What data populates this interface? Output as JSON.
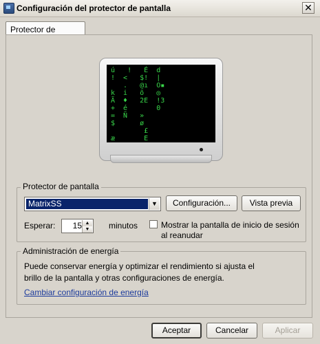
{
  "window": {
    "title": "Configuración del protector de pantalla",
    "close_label": "✕"
  },
  "tabs": [
    {
      "label": "Protector de pantalla",
      "selected": true
    }
  ],
  "preview": {
    "screen_glyphs": [
      "ú   !   É  d",
      "!  <   $!  |",
      "   .   @ı  O▪",
      "k  i   õ   ◎",
      "Ã  ♦   2E  !3",
      "+  é       0",
      "=  Ñ   »",
      "$      ø",
      "        £",
      "æ       E"
    ]
  },
  "screensaver_group": {
    "label": "Protector de pantalla",
    "selected_screensaver": "MatrixSS",
    "settings_button": "Configuración...",
    "preview_button": "Vista previa",
    "wait_label": "Esperar:",
    "wait_value": "15",
    "wait_unit": "minutos",
    "resume_checkbox_label_line1": "Mostrar la pantalla de inicio de sesión",
    "resume_checkbox_label_line2": "al reanudar",
    "resume_checked": false
  },
  "power_group": {
    "label": "Administración de energía",
    "description_line1": "Puede conservar energía y optimizar el rendimiento si ajusta el",
    "description_line2": "brillo de la pantalla y otras configuraciones de energía.",
    "link_text": "Cambiar configuración de energía"
  },
  "footer": {
    "accept": "Aceptar",
    "cancel": "Cancelar",
    "apply": "Aplicar"
  },
  "colors": {
    "selection": "#0a246a",
    "link": "#1b3a9c",
    "matrix_green": "#39d64a"
  }
}
